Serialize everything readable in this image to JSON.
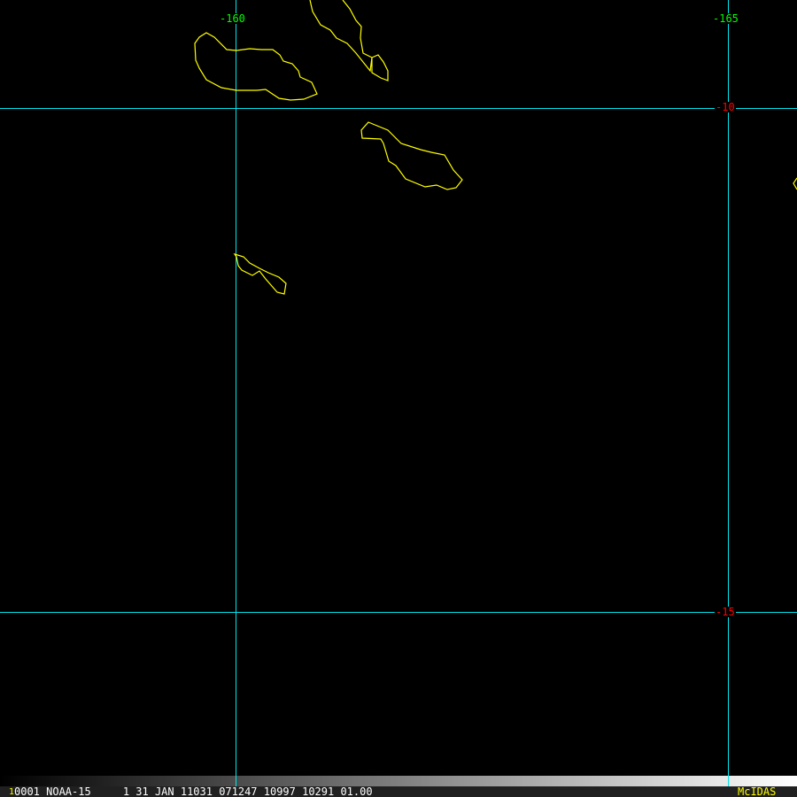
{
  "map": {
    "longitude_labels": [
      "-160",
      "-165"
    ],
    "latitude_labels": [
      "-10",
      "-15"
    ],
    "colors": {
      "grid": "#00e5ee",
      "coast": "#ffff00",
      "lon_label": "#00ff00",
      "lat_label": "#ff0000"
    }
  },
  "status_bar": {
    "frame_number": "1",
    "info": "0001 NOAA-15     1 31 JAN 11031 071247 10997 10291 01.00",
    "brand": "McIDAS"
  }
}
